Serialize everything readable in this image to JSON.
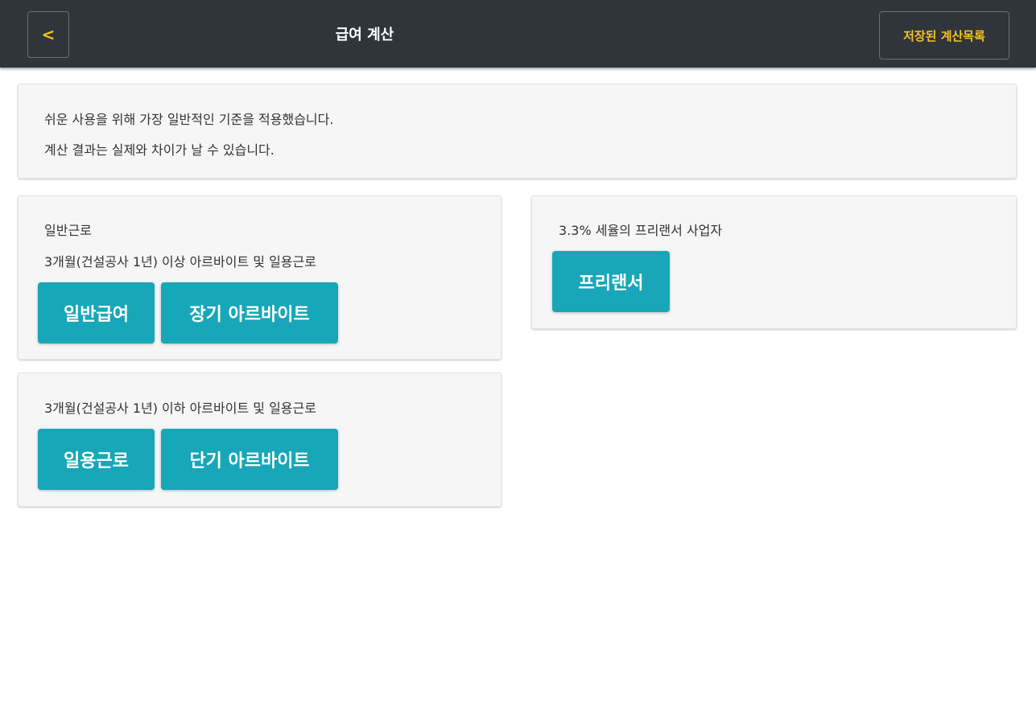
{
  "header": {
    "back_label": "<",
    "title": "급여 계산",
    "saved_label": "저장된 계산목록"
  },
  "notice": {
    "line1": "쉬운 사용을 위해 가장 일반적인 기준을 적용했습니다.",
    "line2": "계산 결과는 실제와 차이가 날 수 있습니다."
  },
  "general": {
    "heading": "일반근로",
    "description": "3개월(건설공사 1년) 이상 아르바이트 및 일용근로",
    "buttons": [
      "일반급여",
      "장기 아르바이트"
    ]
  },
  "short": {
    "description": "3개월(건설공사 1년) 이하 아르바이트 및 일용근로",
    "buttons": [
      "일용근로",
      "단기 아르바이트"
    ]
  },
  "freelancer": {
    "description": "3.3% 세율의 프리랜서 사업자",
    "button": "프리랜서"
  },
  "colors": {
    "header_bg": "#30353c",
    "accent_yellow": "#f2c31f",
    "button_teal": "#17a7b8",
    "card_bg": "#f6f6f6"
  }
}
